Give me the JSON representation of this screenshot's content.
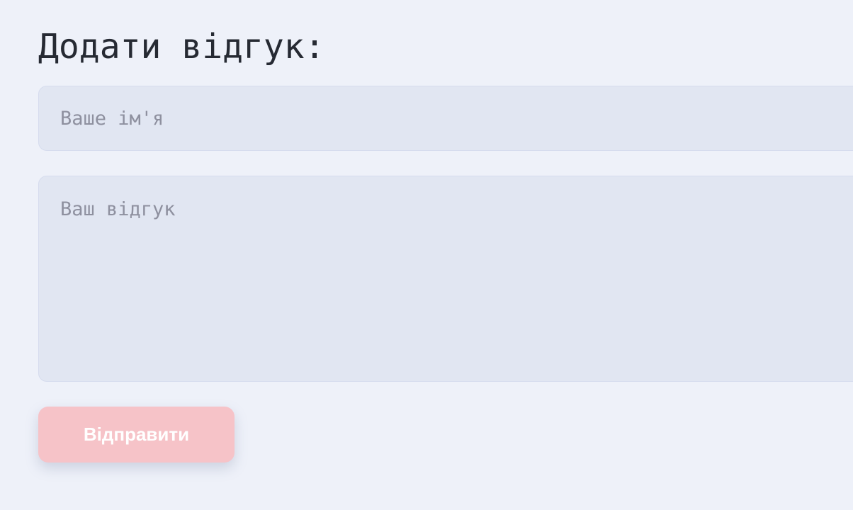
{
  "form": {
    "title": "Додати відгук:",
    "name_placeholder": "Ваше ім'я",
    "review_placeholder": "Ваш відгук",
    "submit_label": "Відправити"
  },
  "colors": {
    "background": "#eef1f9",
    "field_background": "#e1e6f2",
    "button_background": "#f6c3c8",
    "title_text": "#262a33",
    "placeholder_text": "#8e909f"
  }
}
